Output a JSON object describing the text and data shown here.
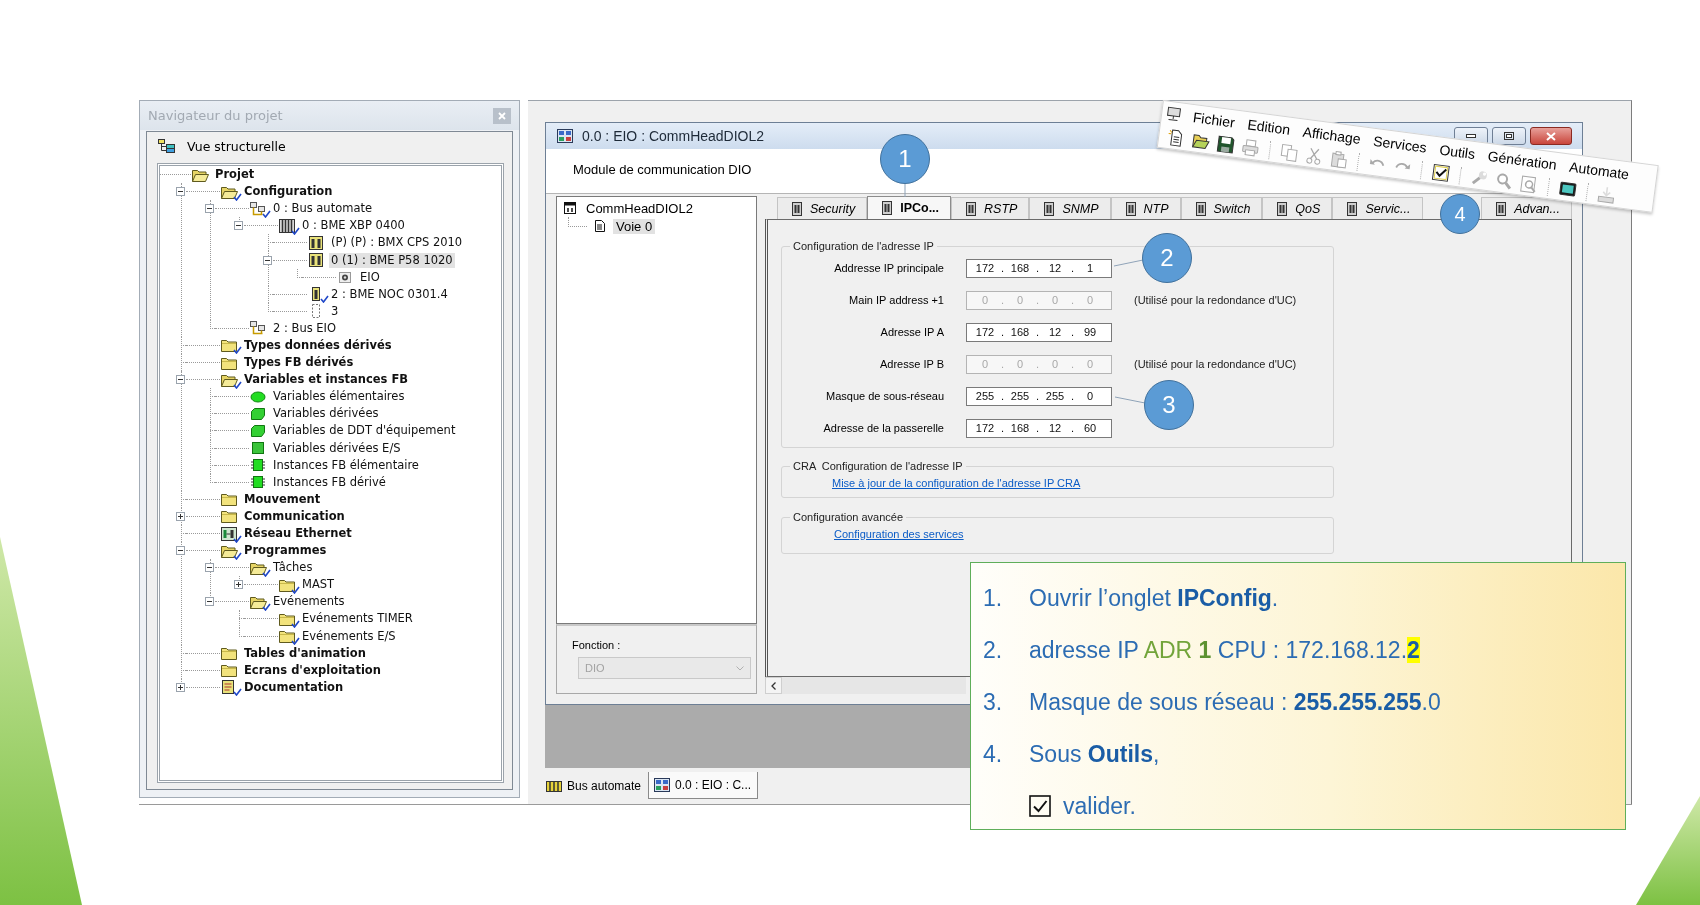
{
  "project_navigator": {
    "title": "Navigateur du projet",
    "view_label": "Vue structurelle",
    "tree": [
      {
        "label": "Projet",
        "kind": "folder",
        "validated": false,
        "selected": false,
        "children": [
          {
            "label": "Configuration",
            "kind": "folder",
            "expanded": true,
            "validated": true,
            "selected": false,
            "children": [
              {
                "label": "0 : Bus automate",
                "kind": "bus",
                "expanded": true,
                "validated": true,
                "selected": false,
                "children": [
                  {
                    "label": "0 : BME XBP 0400",
                    "kind": "rack",
                    "expanded": true,
                    "validated": true,
                    "selected": false,
                    "children": [
                      {
                        "label": "(P) (P) : BMX CPS 2010",
                        "kind": "module",
                        "validated": false,
                        "selected": false
                      },
                      {
                        "label": "0 (1) : BME P58 1020",
                        "kind": "module",
                        "expanded": true,
                        "validated": false,
                        "selected": true,
                        "children": [
                          {
                            "label": "EIO",
                            "kind": "port",
                            "validated": false,
                            "selected": false
                          }
                        ]
                      },
                      {
                        "label": "2 : BME NOC 0301.4",
                        "kind": "module_single",
                        "validated": true,
                        "selected": false
                      },
                      {
                        "label": "3",
                        "kind": "slot",
                        "validated": false,
                        "selected": false
                      }
                    ]
                  }
                ]
              },
              {
                "label": "2 : Bus EIO",
                "kind": "bus",
                "validated": false,
                "selected": false
              }
            ]
          },
          {
            "label": "Types données dérivés",
            "kind": "folder",
            "validated": true,
            "selected": false
          },
          {
            "label": "Types FB dérivés",
            "kind": "folder",
            "validated": false,
            "selected": false
          },
          {
            "label": "Variables et instances FB",
            "kind": "folder",
            "expanded": true,
            "validated": true,
            "selected": false,
            "children": [
              {
                "label": "Variables élémentaires",
                "kind": "var_round",
                "validated": false,
                "selected": false
              },
              {
                "label": "Variables dérivées",
                "kind": "var_block",
                "validated": false,
                "selected": false
              },
              {
                "label": "Variables de DDT d'équipement",
                "kind": "var_block",
                "validated": false,
                "selected": false
              },
              {
                "label": "Variables dérivées E/S",
                "kind": "var_square",
                "validated": false,
                "selected": false
              },
              {
                "label": "Instances FB élémentaire",
                "kind": "fb",
                "validated": false,
                "selected": false
              },
              {
                "label": "Instances FB dérivé",
                "kind": "fb",
                "validated": false,
                "selected": false
              }
            ]
          },
          {
            "label": "Mouvement",
            "kind": "folder",
            "validated": false,
            "selected": false
          },
          {
            "label": "Communication",
            "kind": "folder",
            "expanded": false,
            "validated": false,
            "selected": false
          },
          {
            "label": "Réseau Ethernet",
            "kind": "network",
            "validated": true,
            "selected": false
          },
          {
            "label": "Programmes",
            "kind": "folder",
            "expanded": true,
            "validated": true,
            "selected": false,
            "children": [
              {
                "label": "Tâches",
                "kind": "folder",
                "expanded": true,
                "validated": true,
                "selected": false,
                "children": [
                  {
                    "label": "MAST",
                    "kind": "folder",
                    "expanded": false,
                    "validated": true,
                    "selected": false
                  }
                ]
              },
              {
                "label": "Evénements",
                "kind": "folder",
                "expanded": true,
                "validated": true,
                "selected": false,
                "children": [
                  {
                    "label": "Evénements TIMER",
                    "kind": "folder",
                    "validated": true,
                    "selected": false
                  },
                  {
                    "label": "Evénements E/S",
                    "kind": "folder",
                    "validated": true,
                    "selected": false
                  }
                ]
              }
            ]
          },
          {
            "label": "Tables d'animation",
            "kind": "folder",
            "validated": false,
            "selected": false
          },
          {
            "label": "Ecrans d'exploitation",
            "kind": "folder",
            "validated": false,
            "selected": false
          },
          {
            "label": "Documentation",
            "kind": "doc",
            "expanded": false,
            "validated": true,
            "selected": false
          }
        ]
      }
    ]
  },
  "editor": {
    "title": "0.0 : EIO : CommHeadDIOL2",
    "header": "Module de communication DIO",
    "module_tree": [
      {
        "label": "CommHeadDIOL2",
        "selected": false,
        "children": [
          {
            "label": "Voie 0",
            "selected": true
          }
        ]
      }
    ],
    "function": {
      "label": "Fonction :",
      "value": "DIO",
      "disabled": true
    },
    "tabs": [
      {
        "label": "Security",
        "selected": false
      },
      {
        "label": "IPCo...",
        "selected": true
      },
      {
        "label": "RSTP",
        "selected": false
      },
      {
        "label": "SNMP",
        "selected": false
      },
      {
        "label": "NTP",
        "selected": false
      },
      {
        "label": "Switch",
        "selected": false
      },
      {
        "label": "QoS",
        "selected": false
      },
      {
        "label": "Servic...",
        "selected": false
      },
      {
        "label": "Advan...",
        "selected": false
      }
    ],
    "ip_config": {
      "title": "Configuration de l'adresse IP",
      "separator": ".",
      "rows": [
        {
          "label": "Addresse IP principale",
          "octets": [
            "172",
            "168",
            "12",
            "1"
          ],
          "disabled": false
        },
        {
          "label": "Main IP address +1",
          "octets": [
            "0",
            "0",
            "0",
            "0"
          ],
          "disabled": true,
          "note": "(Utilisé pour la redondance d'UC)"
        },
        {
          "label": "Adresse IP A",
          "octets": [
            "172",
            "168",
            "12",
            "99"
          ],
          "disabled": false
        },
        {
          "label": "Adresse IP B",
          "octets": [
            "0",
            "0",
            "0",
            "0"
          ],
          "disabled": true,
          "note": "(Utilisé pour la redondance d'UC)"
        },
        {
          "label": "Masque de sous-réseau",
          "octets": [
            "255",
            "255",
            "255",
            "0"
          ],
          "disabled": false
        },
        {
          "label": "Adresse de la passerelle",
          "octets": [
            "172",
            "168",
            "12",
            "60"
          ],
          "disabled": false
        }
      ]
    },
    "cra": {
      "title": "CRA  Configuration de l'adresse IP",
      "link": "Mise à jour de la configuration de l'adresse IP CRA"
    },
    "advanced": {
      "title": "Configuration avancée",
      "link": "Configuration des services"
    }
  },
  "document_tabs": [
    {
      "label": "Bus automate",
      "kind": "bus",
      "selected": false
    },
    {
      "label": "0.0 : EIO : C...",
      "kind": "module",
      "selected": true
    }
  ],
  "menu_strip": {
    "menus": [
      "Fichier",
      "Edition",
      "Affichage",
      "Services",
      "Outils",
      "Génération",
      "Automate"
    ],
    "toolbar_groups": [
      {
        "buttons": [
          {
            "kind": "new",
            "disabled": false
          },
          {
            "kind": "open",
            "disabled": false
          },
          {
            "kind": "save",
            "disabled": false
          },
          {
            "kind": "print",
            "disabled": true
          }
        ]
      },
      {
        "buttons": [
          {
            "kind": "copy",
            "disabled": true
          },
          {
            "kind": "cut",
            "disabled": true
          },
          {
            "kind": "paste",
            "disabled": true
          }
        ]
      },
      {
        "buttons": [
          {
            "kind": "undo",
            "disabled": true
          },
          {
            "kind": "redo",
            "disabled": true
          }
        ]
      },
      {
        "buttons": [
          {
            "kind": "validate",
            "disabled": false
          }
        ]
      },
      {
        "buttons": [
          {
            "kind": "build",
            "disabled": true
          },
          {
            "kind": "rebuild",
            "disabled": true
          },
          {
            "kind": "analyze",
            "disabled": true
          }
        ]
      },
      {
        "buttons": [
          {
            "kind": "connect",
            "disabled": false
          }
        ]
      },
      {
        "buttons": [
          {
            "kind": "transfer",
            "disabled": true
          }
        ]
      }
    ]
  },
  "callouts": [
    "1",
    "2",
    "3",
    "4"
  ],
  "note": {
    "steps": [
      {
        "number": "1.",
        "kind": "text",
        "segments": [
          {
            "text": "Ouvrir l’onglet ",
            "kind": "plain"
          },
          {
            "text": "IPConfig",
            "kind": "strong"
          },
          {
            "text": ".",
            "kind": "plain"
          }
        ]
      },
      {
        "number": "2.",
        "kind": "text",
        "segments": [
          {
            "text": "adresse IP ",
            "kind": "plain"
          },
          {
            "text": "ADR ",
            "kind": "accent"
          },
          {
            "text": "1",
            "kind": "accent_strong"
          },
          {
            "text": " CPU : 172.168.12.",
            "kind": "plain"
          },
          {
            "text": "2",
            "kind": "highlight"
          }
        ]
      },
      {
        "number": "3.",
        "kind": "text",
        "segments": [
          {
            "text": "Masque de sous réseau : ",
            "kind": "plain"
          },
          {
            "text": "255.255.255",
            "kind": "strong"
          },
          {
            "text": ".0",
            "kind": "plain"
          }
        ]
      },
      {
        "number": "4.",
        "kind": "text",
        "segments": [
          {
            "text": "Sous ",
            "kind": "plain"
          },
          {
            "text": "Outils",
            "kind": "strong"
          },
          {
            "text": ",",
            "kind": "plain"
          }
        ]
      },
      {
        "kind": "check",
        "segments": [
          {
            "text": "valider.",
            "kind": "plain"
          }
        ]
      }
    ]
  }
}
